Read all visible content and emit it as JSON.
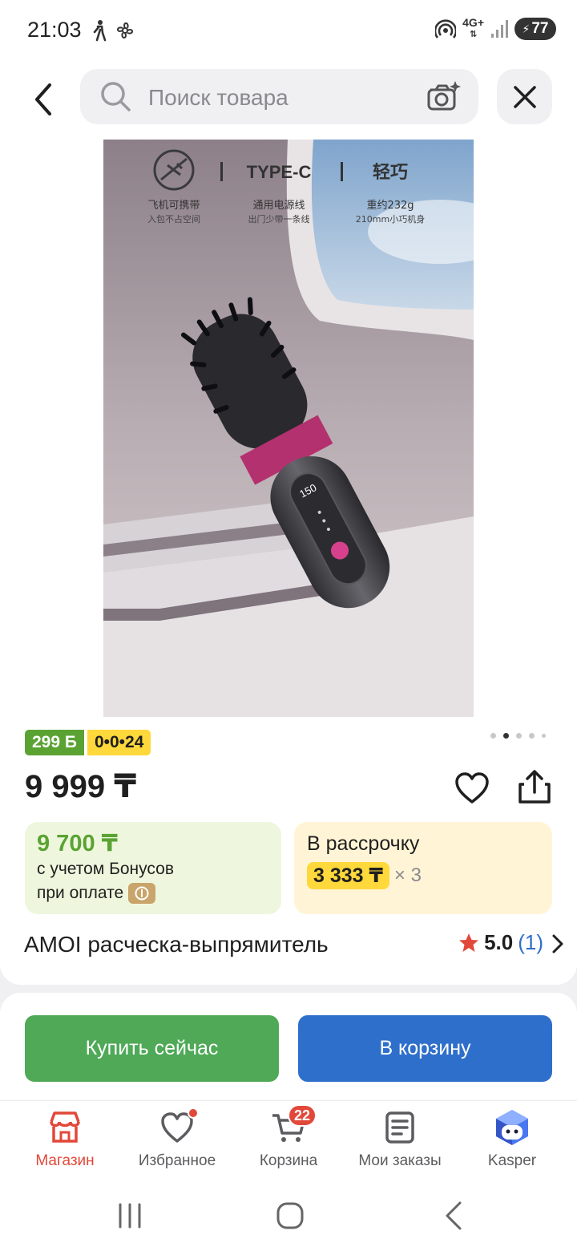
{
  "status_bar": {
    "time": "21:03",
    "network": "4G+",
    "battery": "77",
    "icons": [
      "walking-icon",
      "fan-icon",
      "hotspot-icon",
      "signal-icon",
      "battery-icon"
    ]
  },
  "header": {
    "search_placeholder": "Поиск товара",
    "icons": [
      "back-icon",
      "search-icon",
      "camera-ai-icon",
      "close-icon"
    ]
  },
  "product": {
    "image": {
      "feature_1_title": "飞机可携带",
      "feature_1_sub": "入包不占空间",
      "feature_2_head": "TYPE-C",
      "feature_2_title": "通用电源线",
      "feature_2_sub": "出门少带一条线",
      "feature_3_head": "轻巧",
      "feature_3_title": "重约232g",
      "feature_3_sub": "210mm小巧机身",
      "display_value": "150"
    },
    "badge_bonus": "299 Б",
    "badge_installment": "0•0•24",
    "gallery_pages": 5,
    "gallery_current": 2,
    "price": "9 999 ₸",
    "bonus_price": "9 700 ₸",
    "bonus_line1": "с учетом Бонусов",
    "bonus_line2": "при оплате",
    "installment_title": "В рассрочку",
    "installment_amount": "3 333 ₸",
    "installment_multiplier": "× 3",
    "title": "AMOI расческа-выпрямитель",
    "rating": "5.0",
    "reviews_count": "(1)"
  },
  "actions": {
    "buy_now": "Купить сейчас",
    "add_to_cart": "В корзину"
  },
  "bottom_nav": {
    "items": [
      {
        "label": "Магазин",
        "active": true
      },
      {
        "label": "Избранное"
      },
      {
        "label": "Корзина",
        "badge": "22"
      },
      {
        "label": "Мои заказы"
      },
      {
        "label": "Kasper"
      }
    ]
  },
  "colors": {
    "green": "#5aa333",
    "blue": "#2f6fcc",
    "red": "#e2483a",
    "yellow": "#ffd83b"
  }
}
